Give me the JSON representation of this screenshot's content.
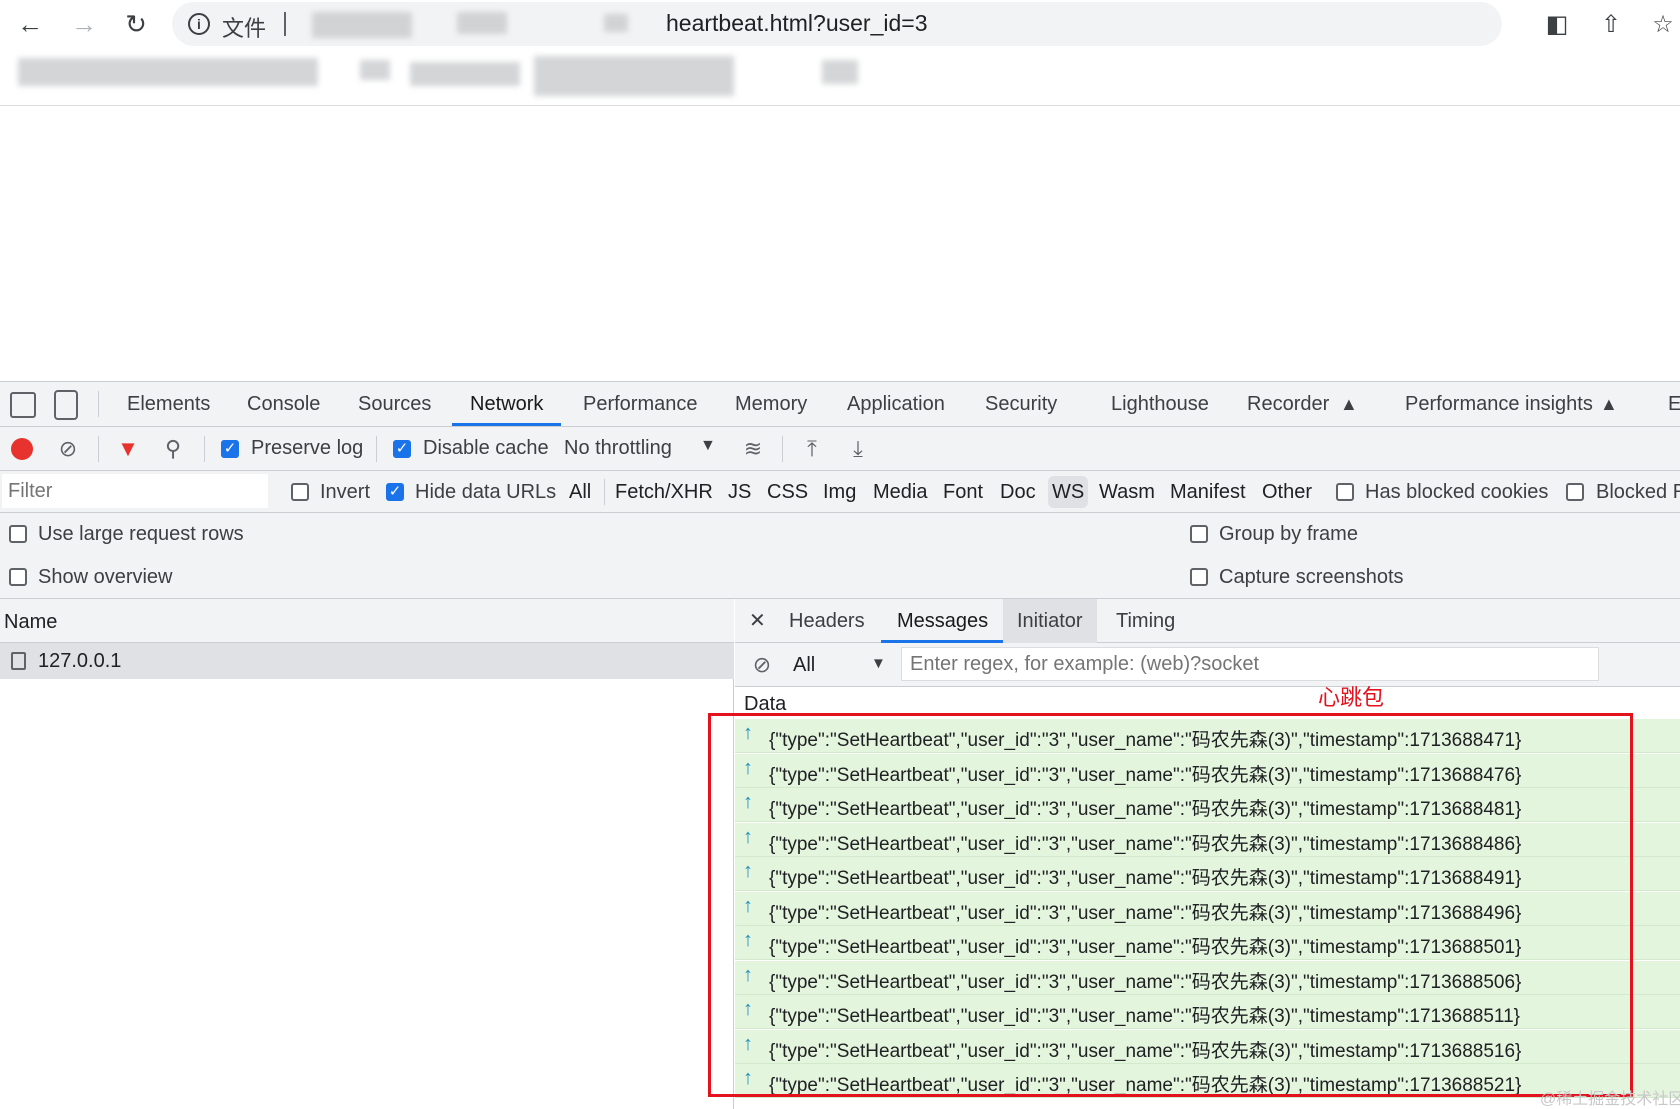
{
  "browser": {
    "file_label": "文件",
    "url_tail": "heartbeat.html?user_id=3"
  },
  "devtools": {
    "tabs": [
      "Elements",
      "Console",
      "Sources",
      "Network",
      "Performance",
      "Memory",
      "Application",
      "Security",
      "Lighthouse",
      "Recorder",
      "Performance insights",
      "E"
    ],
    "active_tab": "Network"
  },
  "toolbar": {
    "preserve_log": "Preserve log",
    "disable_cache": "Disable cache",
    "throttling": "No throttling"
  },
  "filterbar": {
    "filter_placeholder": "Filter",
    "invert": "Invert",
    "hide_data_urls": "Hide data URLs",
    "types": [
      "All",
      "Fetch/XHR",
      "JS",
      "CSS",
      "Img",
      "Media",
      "Font",
      "Doc",
      "WS",
      "Wasm",
      "Manifest",
      "Other"
    ],
    "has_blocked_cookies": "Has blocked cookies",
    "blocked": "Blocked R"
  },
  "settings": {
    "large_rows": "Use large request rows",
    "show_overview": "Show overview",
    "group_by_frame": "Group by frame",
    "capture_screenshots": "Capture screenshots"
  },
  "requests": {
    "header": "Name",
    "items": [
      "127.0.0.1"
    ]
  },
  "detail": {
    "tabs": [
      "Headers",
      "Messages",
      "Initiator",
      "Timing"
    ],
    "active_tab": "Messages",
    "filter_all": "All",
    "regex_placeholder": "Enter regex, for example: (web)?socket",
    "data_header": "Data"
  },
  "messages": [
    "{\"type\":\"SetHeartbeat\",\"user_id\":\"3\",\"user_name\":\"码农先森(3)\",\"timestamp\":1713688471}",
    "{\"type\":\"SetHeartbeat\",\"user_id\":\"3\",\"user_name\":\"码农先森(3)\",\"timestamp\":1713688476}",
    "{\"type\":\"SetHeartbeat\",\"user_id\":\"3\",\"user_name\":\"码农先森(3)\",\"timestamp\":1713688481}",
    "{\"type\":\"SetHeartbeat\",\"user_id\":\"3\",\"user_name\":\"码农先森(3)\",\"timestamp\":1713688486}",
    "{\"type\":\"SetHeartbeat\",\"user_id\":\"3\",\"user_name\":\"码农先森(3)\",\"timestamp\":1713688491}",
    "{\"type\":\"SetHeartbeat\",\"user_id\":\"3\",\"user_name\":\"码农先森(3)\",\"timestamp\":1713688496}",
    "{\"type\":\"SetHeartbeat\",\"user_id\":\"3\",\"user_name\":\"码农先森(3)\",\"timestamp\":1713688501}",
    "{\"type\":\"SetHeartbeat\",\"user_id\":\"3\",\"user_name\":\"码农先森(3)\",\"timestamp\":1713688506}",
    "{\"type\":\"SetHeartbeat\",\"user_id\":\"3\",\"user_name\":\"码农先森(3)\",\"timestamp\":1713688511}",
    "{\"type\":\"SetHeartbeat\",\"user_id\":\"3\",\"user_name\":\"码农先森(3)\",\"timestamp\":1713688516}",
    "{\"type\":\"SetHeartbeat\",\"user_id\":\"3\",\"user_name\":\"码农先森(3)\",\"timestamp\":1713688521}"
  ],
  "annotation": "心跳包",
  "watermark": "@稀土掘金技术社区",
  "colors": {
    "accent": "#1a73e8",
    "record": "#e8322d",
    "message_bg": "#e4f5de",
    "annotation": "#e3121c"
  }
}
